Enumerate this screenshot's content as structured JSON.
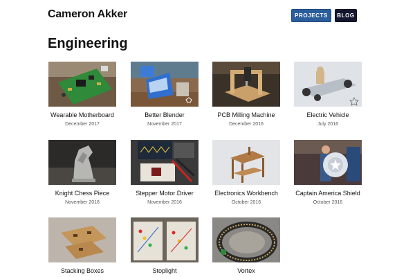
{
  "header": {
    "site_title": "Cameron Akker",
    "nav": [
      {
        "label": "PROJECTS"
      },
      {
        "label": "BLOG"
      }
    ]
  },
  "section": {
    "title": "Engineering"
  },
  "projects": [
    {
      "title": "Wearable Motherboard",
      "date": "December 2017",
      "thumb_icon": "green-circuit-board-photo"
    },
    {
      "title": "Better Blender",
      "date": "November 2017",
      "thumb_icon": "blue-blender-photo"
    },
    {
      "title": "PCB Milling Machine",
      "date": "December 2016",
      "thumb_icon": "milling-machine-photo"
    },
    {
      "title": "Electric Vehicle",
      "date": "July 2016",
      "thumb_icon": "vehicle-cad-render"
    },
    {
      "title": "Knight Chess Piece",
      "date": "November 2016",
      "thumb_icon": "metal-chess-knight-photo"
    },
    {
      "title": "Stepper Motor Driver",
      "date": "November 2016",
      "thumb_icon": "oscilloscope-breadboard-photo"
    },
    {
      "title": "Electronics Workbench",
      "date": "October 2016",
      "thumb_icon": "workbench-cad-render"
    },
    {
      "title": "Captain America Shield",
      "date": "October 2016",
      "thumb_icon": "person-with-shield-photo"
    },
    {
      "title": "Stacking Boxes",
      "date": "",
      "thumb_icon": "wooden-boxes-photo"
    },
    {
      "title": "Stoplight",
      "date": "",
      "thumb_icon": "breadboards-leds-photo"
    },
    {
      "title": "Vortex",
      "date": "",
      "thumb_icon": "coil-ring-photo"
    }
  ]
}
